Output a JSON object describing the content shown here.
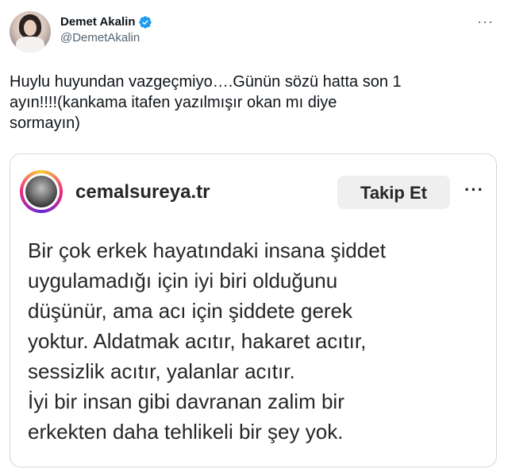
{
  "tweet": {
    "author": {
      "display_name": "Demet Akalin",
      "handle": "@DemetAkalin",
      "verified": true
    },
    "more_icon": "more-horizontal-icon",
    "text": "Huylu huyundan vazgeçmiyo….Günün sözü hatta son 1\nayın!!!!(kankama itafen yazılmışır okan mı diye\nsormayın)"
  },
  "embed": {
    "username": "cemalsureya.tr",
    "follow_label": "Takip Et",
    "more_icon": "more-horizontal-icon",
    "quote": "Bir çok erkek hayatındaki insana şiddet\nuygulamadığı için iyi biri olduğunu\ndüşünür, ama acı için şiddete gerek\nyoktur. Aldatmak acıtır, hakaret acıtır,\nsessizlik acıtır, yalanlar acıtır.\nİyi bir insan gibi davranan zalim bir\nerkekten daha tehlikeli bir şey yok."
  },
  "colors": {
    "verified": "#1d9bf0",
    "secondary_text": "#536471",
    "border": "#cfd9de",
    "follow_bg": "#efefef"
  }
}
